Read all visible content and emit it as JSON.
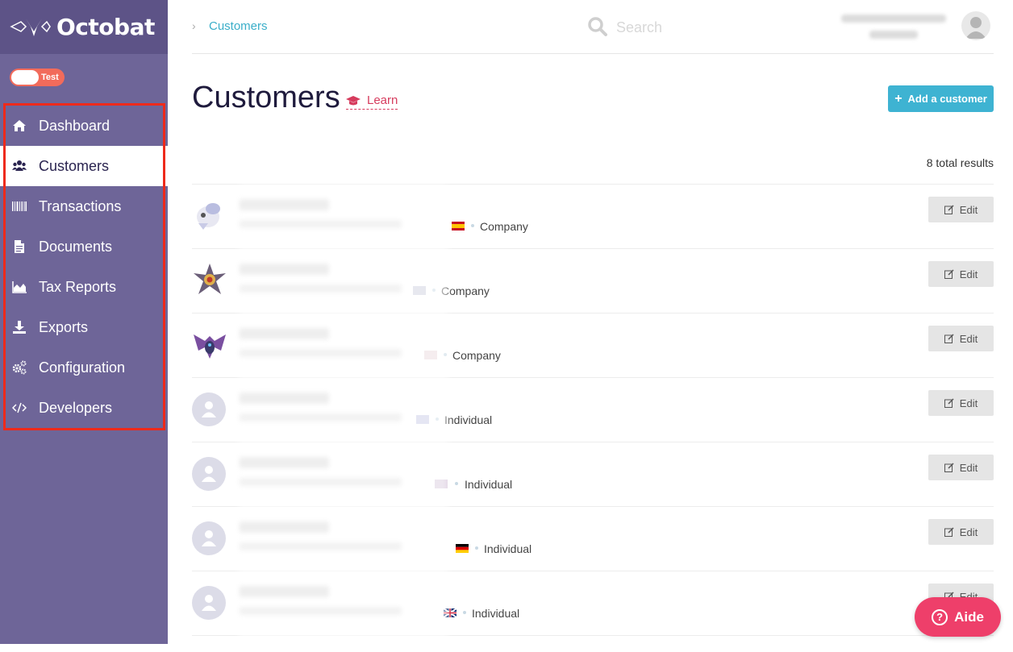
{
  "app": {
    "name": "Octobat"
  },
  "mode_toggle": {
    "label": "Test"
  },
  "sidebar": {
    "items": [
      {
        "label": "Dashboard",
        "icon": "home-icon",
        "active": false
      },
      {
        "label": "Customers",
        "icon": "users-icon",
        "active": true
      },
      {
        "label": "Transactions",
        "icon": "barcode-icon",
        "active": false
      },
      {
        "label": "Documents",
        "icon": "document-icon",
        "active": false
      },
      {
        "label": "Tax Reports",
        "icon": "area-chart-icon",
        "active": false
      },
      {
        "label": "Exports",
        "icon": "download-icon",
        "active": false
      },
      {
        "label": "Configuration",
        "icon": "gears-icon",
        "active": false
      },
      {
        "label": "Developers",
        "icon": "code-icon",
        "active": false
      }
    ]
  },
  "topbar": {
    "breadcrumb": "Customers",
    "search_placeholder": "Search"
  },
  "header": {
    "title": "Customers",
    "learn_label": "Learn",
    "add_button_label": "Add a customer"
  },
  "results": {
    "total_label": "8 total results"
  },
  "customers": [
    {
      "type": "Company",
      "flag": "es",
      "avatar": "pokemon-1"
    },
    {
      "type": "Company",
      "flag": "us",
      "avatar": "pokemon-2"
    },
    {
      "type": "Company",
      "flag": "fr",
      "avatar": "pokemon-3"
    },
    {
      "type": "Individual",
      "flag": "eu",
      "avatar": "placeholder"
    },
    {
      "type": "Individual",
      "flag": "us",
      "avatar": "placeholder"
    },
    {
      "type": "Individual",
      "flag": "de",
      "avatar": "placeholder"
    },
    {
      "type": "Individual",
      "flag": "gb",
      "avatar": "placeholder"
    }
  ],
  "row_action": {
    "edit_label": "Edit"
  },
  "help": {
    "label": "Aide"
  },
  "colors": {
    "sidebar": "#6e6598",
    "sidebar_logo": "#5d5387",
    "accent": "#3eb3d2",
    "learn": "#d63b5d",
    "help": "#ee3f6a",
    "toggle": "#f26b5b"
  }
}
